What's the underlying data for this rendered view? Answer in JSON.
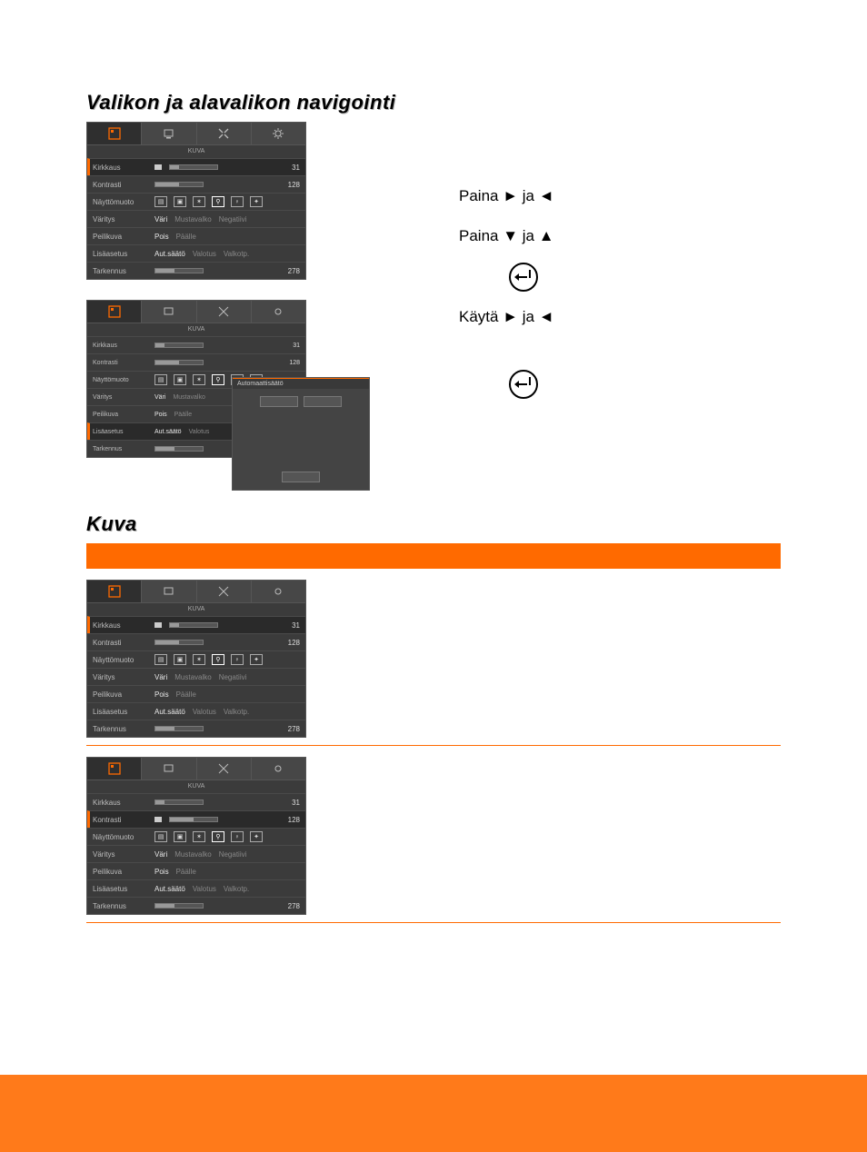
{
  "headings": {
    "nav": "Valikon ja alavalikon navigointi",
    "kuva": "Kuva"
  },
  "instructions": {
    "line1_prefix": "Paina ",
    "line1_mid": " ja ",
    "line2_prefix": "Paina ",
    "line2_mid": " ja ",
    "line4_prefix": "Käytä ",
    "line4_mid": " ja "
  },
  "arrows": {
    "right": "►",
    "left": "◄",
    "down": "▼",
    "up": "▲"
  },
  "osd": {
    "title": "KUVA",
    "rows": {
      "kirkkaus": {
        "label": "Kirkkaus",
        "value": "31"
      },
      "kontrasti": {
        "label": "Kontrasti",
        "value": "128"
      },
      "nayttomuoto": {
        "label": "Näyttömuoto"
      },
      "varitys": {
        "label": "Väritys",
        "opts": [
          "Väri",
          "Mustavalko",
          "Negatiivi"
        ]
      },
      "peilikuva": {
        "label": "Peilikuva",
        "opts": [
          "Pois",
          "Päälle"
        ]
      },
      "lisaasetus": {
        "label": "Lisäasetus",
        "opts": [
          "Aut.säätö",
          "Valotus",
          "Valkotp."
        ]
      },
      "tarkennus": {
        "label": "Tarkennus",
        "value": "278"
      }
    },
    "submenu_header": "Automaattisäätö"
  }
}
